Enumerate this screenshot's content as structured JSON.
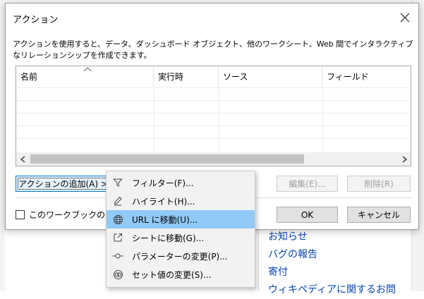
{
  "dialog": {
    "title": "アクション",
    "description": "アクションを使用すると、データ、ダッシュボード オブジェクト、他のワークシート、Web 間でインタラクティブなリレーションシップを作成できます。",
    "table": {
      "columns": [
        "名前",
        "実行時",
        "ソース",
        "フィールド"
      ]
    },
    "add_action_label": "アクションの追加(A) >",
    "edit_label": "編集(E)...",
    "delete_label": "削除(R)",
    "checkbox_label": "このワークブックの全シ",
    "ok_label": "OK",
    "cancel_label": "キャンセル"
  },
  "menu": {
    "items": [
      {
        "label": "フィルター(F)...",
        "icon": "filter-icon"
      },
      {
        "label": "ハイライト(H)...",
        "icon": "highlighter-icon"
      },
      {
        "label": "URL に移動(U)...",
        "icon": "globe-icon"
      },
      {
        "label": "シートに移動(G)...",
        "icon": "goto-sheet-icon"
      },
      {
        "label": "パラメーターの変更(P)...",
        "icon": "parameter-icon"
      },
      {
        "label": "セット値の変更(S)...",
        "icon": "set-icon"
      }
    ],
    "hover_index": 2
  },
  "background": {
    "links": [
      "お知らせ",
      "バグの報告",
      "寄付",
      "ウィキペディアに関するお問"
    ]
  },
  "colors": {
    "hover": "#91c9f7",
    "link": "#0645ad",
    "focus_border": "#0078d7"
  }
}
